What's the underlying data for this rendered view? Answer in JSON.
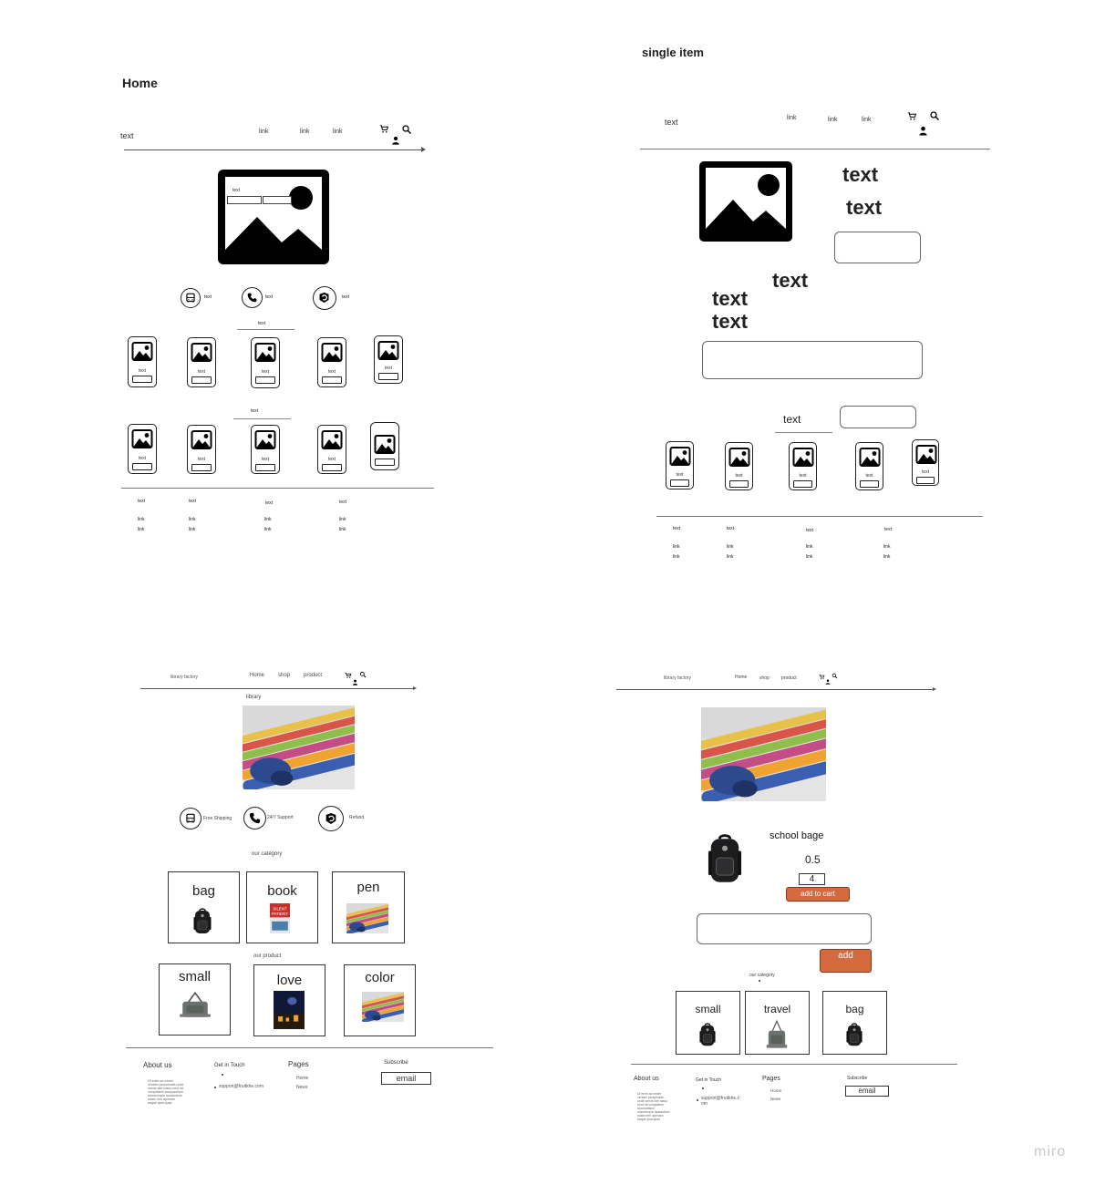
{
  "frames": {
    "home_title": "Home",
    "single_title": "single item"
  },
  "home": {
    "brand": "text",
    "links": [
      "link",
      "link",
      "link"
    ],
    "hero_texts": [
      "text",
      "text"
    ],
    "features": [
      "text",
      "text",
      "text"
    ],
    "section1": "text",
    "section2": "text",
    "card_label": "text",
    "footer_heads": [
      "text",
      "text",
      "text",
      "text"
    ],
    "footer_link": "link"
  },
  "single": {
    "brand": "text",
    "links": [
      "link",
      "link",
      "link"
    ],
    "big1": "text",
    "big2": "text",
    "big3": "text",
    "big4": "text",
    "big5": "text",
    "related": "text",
    "card_label": "text",
    "footer_heads": [
      "text",
      "text",
      "text",
      "text"
    ],
    "footer_link": "link"
  },
  "library": {
    "brand": "library factory",
    "nav": [
      "Home",
      "shop",
      "product"
    ],
    "hero_label": "library",
    "features": [
      "Free Shipping",
      "24/7 Support",
      "Refund"
    ],
    "category_title": "our category",
    "categories": [
      "bag",
      "book",
      "pen"
    ],
    "product_title": "our product",
    "products": [
      "small",
      "love",
      "color"
    ],
    "book_cover": "SILENT PATIENT",
    "footer": {
      "about": "About us",
      "about_text": "Ut enim ad minim veniam perspiciatis unde omnis iste natus error sit voluptatem accusantium doloremque laudantium totam rem aperiam eaque ipsa quae",
      "touch": "Get in Touch",
      "email_addr": "support@fruitkhe.com",
      "pages": "Pages",
      "pages_links": [
        "Home",
        "News"
      ],
      "subscribe": "Subscribe",
      "email_input": "email"
    }
  },
  "product_page": {
    "brand": "library factory",
    "nav": [
      "Home",
      "shop",
      "product"
    ],
    "product_name": "school bage",
    "price": "0.5",
    "qty": "4",
    "add_to_cart": "add to cart",
    "add": "add",
    "category_title": "our category",
    "categories": [
      "small",
      "travel",
      "bag"
    ],
    "footer": {
      "about": "About us",
      "about_text": "Ut enim ad minim veniam perspiciatis unde omnis iste natus error sit voluptatem accusantium doloremque laudantium totam rem aperiam eaque ipsa quae",
      "touch": "Get in Touch",
      "email_addr": "support@fruitkhe.com",
      "pages": "Pages",
      "pages_links": [
        "Home",
        "News"
      ],
      "subscribe": "Subscribe",
      "email_input": "email"
    }
  },
  "watermark": "miro",
  "colors": {
    "accent_orange": "#d46a3e"
  }
}
